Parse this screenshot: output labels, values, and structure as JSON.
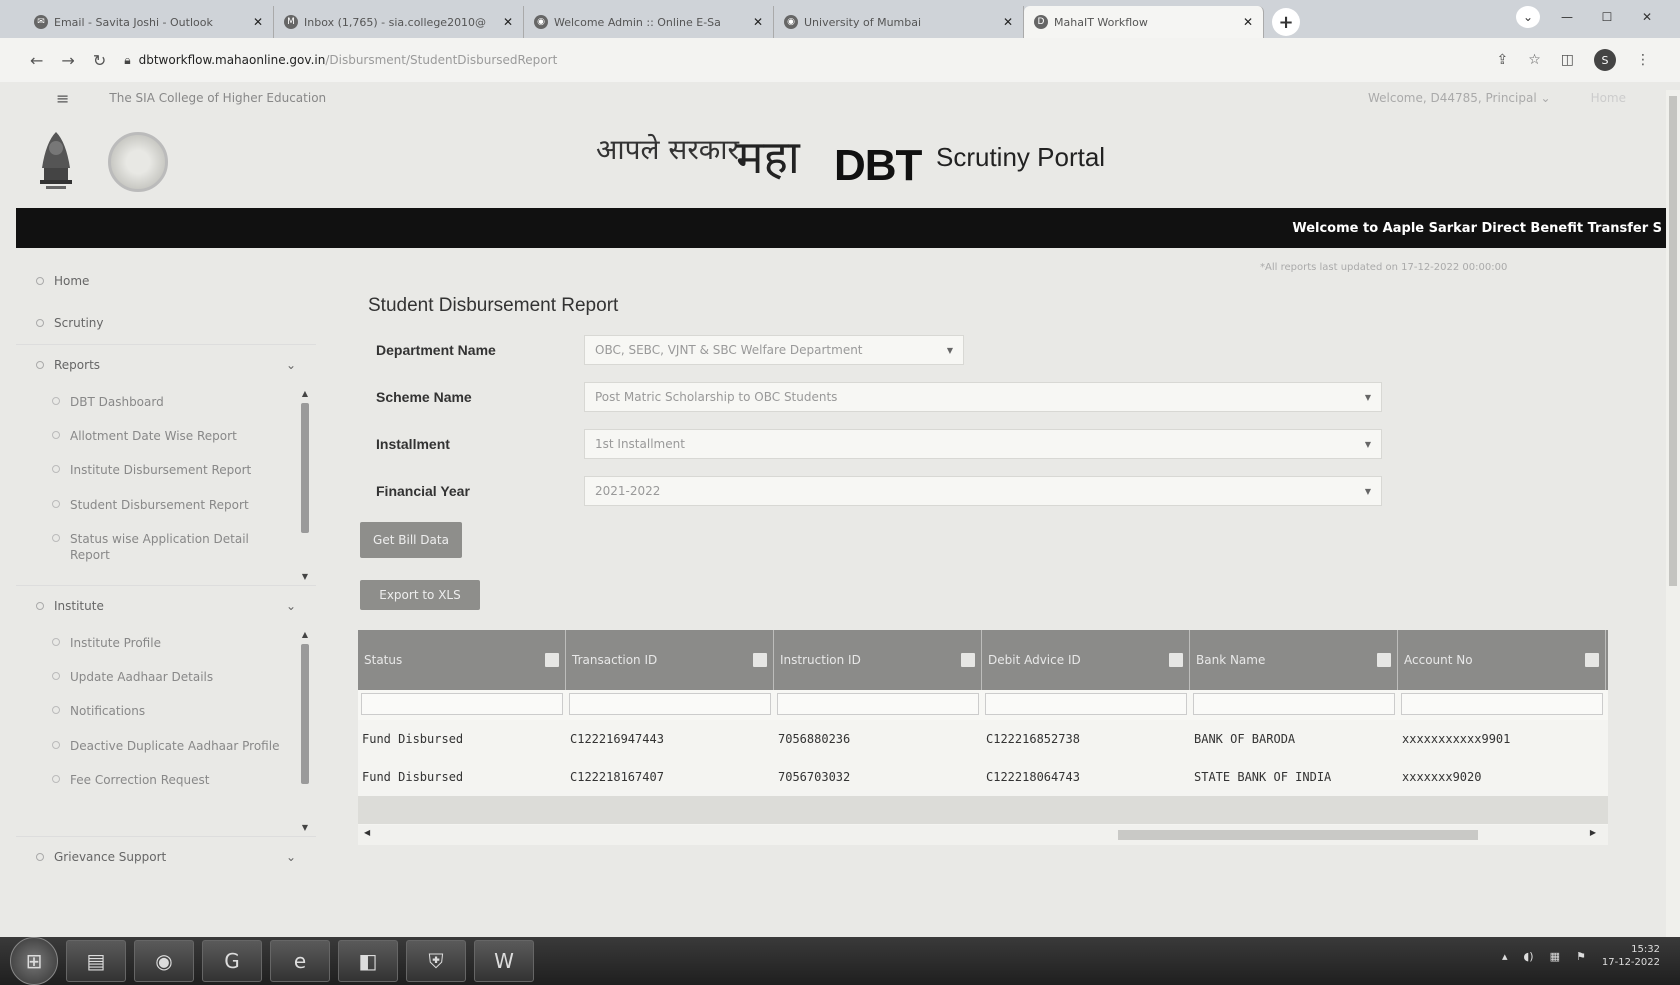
{
  "browser": {
    "tabs": [
      {
        "icon": "outlook-icon",
        "title": "Email - Savita Joshi - Outlook",
        "active": false
      },
      {
        "icon": "gmail-icon",
        "title": "Inbox (1,765) - sia.college2010@",
        "active": false
      },
      {
        "icon": "globe-icon",
        "title": "Welcome Admin :: Online E-Sa",
        "active": false
      },
      {
        "icon": "globe-icon",
        "title": "University of Mumbai",
        "active": false
      },
      {
        "icon": "dbt-icon",
        "title": "MahaIT Workflow",
        "active": true
      }
    ],
    "url_host": "dbtworkflow.mahaonline.gov.in",
    "url_path": "/Disbursment/StudentDisbursedReport"
  },
  "header": {
    "college_name": "The SIA College of Higher Education",
    "welcome": "Welcome, D44785, Principal",
    "home_link": "Home",
    "logo_apale": "आपले सरकार",
    "logo_maha": "महा",
    "logo_dbt": "DBT",
    "portal_name": "Scrutiny Portal",
    "ticker": "Welcome to Aaple Sarkar Direct Benefit Transfer S"
  },
  "sidebar": {
    "home": "Home",
    "scrutiny": "Scrutiny",
    "reports": {
      "label": "Reports",
      "items": [
        "DBT Dashboard",
        "Allotment Date Wise Report",
        "Institute Disbursement Report",
        "Student Disbursement Report",
        "Status wise Application Detail Report"
      ]
    },
    "institute": {
      "label": "Institute",
      "items": [
        "Institute Profile",
        "Update Aadhaar Details",
        "Notifications",
        "Deactive Duplicate Aadhaar Profile",
        "Fee Correction Request"
      ]
    },
    "grievance": "Grievance Support"
  },
  "main": {
    "updated_note": "*All reports last updated on 17-12-2022 00:00:00",
    "title": "Student Disbursement Report",
    "form": {
      "department_label": "Department Name",
      "department_value": "OBC, SEBC, VJNT & SBC Welfare Department",
      "scheme_label": "Scheme Name",
      "scheme_value": "Post Matric Scholarship to OBC Students",
      "installment_label": "Installment",
      "installment_value": "1st Installment",
      "year_label": "Financial Year",
      "year_value": "2021-2022"
    },
    "get_bill_btn": "Get Bill Data",
    "export_btn": "Export to XLS",
    "grid": {
      "columns": [
        "Status",
        "Transaction ID",
        "Instruction ID",
        "Debit Advice ID",
        "Bank Name",
        "Account No"
      ],
      "rows": [
        [
          "Fund Disbursed",
          "C122216947443",
          "7056880236",
          "C122216852738",
          "BANK OF BARODA",
          "xxxxxxxxxxx9901"
        ],
        [
          "Fund Disbursed",
          "C122218167407",
          "7056703032",
          "C122218064743",
          "STATE BANK OF INDIA",
          "xxxxxxx9020"
        ]
      ]
    }
  },
  "taskbar": {
    "time": "15:32",
    "date": "17-12-2022"
  },
  "colors": {
    "ticker_bg": "#111111",
    "grid_header": "#8b8b89",
    "button": "#8e8e8b"
  }
}
